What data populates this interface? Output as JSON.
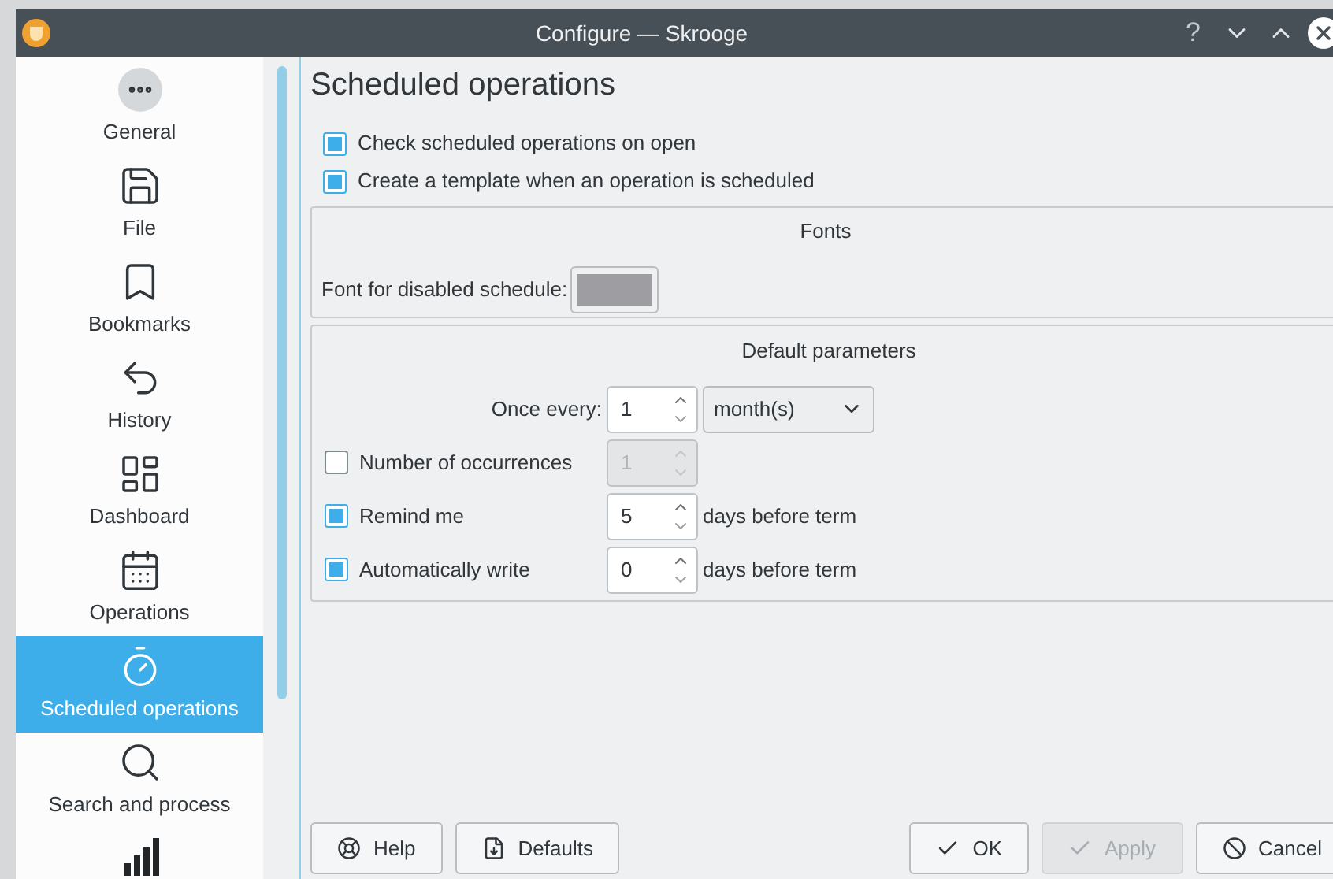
{
  "window": {
    "title": "Configure — Skrooge",
    "help_glyph": "?"
  },
  "sidebar": {
    "items": [
      {
        "label": "General",
        "selected": false
      },
      {
        "label": "File",
        "selected": false
      },
      {
        "label": "Bookmarks",
        "selected": false
      },
      {
        "label": "History",
        "selected": false
      },
      {
        "label": "Dashboard",
        "selected": false
      },
      {
        "label": "Operations",
        "selected": false
      },
      {
        "label": "Scheduled operations",
        "selected": true
      },
      {
        "label": "Search and process",
        "selected": false
      }
    ]
  },
  "page": {
    "title": "Scheduled operations",
    "options": [
      {
        "label": "Check scheduled operations on open",
        "checked": true
      },
      {
        "label": "Create a template when an operation is scheduled",
        "checked": true
      }
    ],
    "fonts_group": {
      "title": "Fonts",
      "label": "Font for disabled schedule:",
      "color": "#9e9ea2"
    },
    "defaults_group": {
      "title": "Default parameters",
      "once_every": {
        "label": "Once every:",
        "value": "1",
        "unit": "month(s)"
      },
      "rows": [
        {
          "label": "Number of occurrences",
          "checked": false,
          "value": "1",
          "disabled": true
        },
        {
          "label": "Remind me",
          "checked": true,
          "value": "5",
          "disabled": false,
          "suffix": "days before term"
        },
        {
          "label": "Automatically write",
          "checked": true,
          "value": "0",
          "disabled": false,
          "suffix": "days before term"
        }
      ]
    }
  },
  "buttons": [
    {
      "label": "Help",
      "kind": "help",
      "disabled": false
    },
    {
      "label": "Defaults",
      "kind": "defaults",
      "disabled": false
    },
    {
      "label": "OK",
      "kind": "ok",
      "disabled": false
    },
    {
      "label": "Apply",
      "kind": "apply",
      "disabled": true
    },
    {
      "label": "Cancel",
      "kind": "cancel",
      "disabled": false
    }
  ]
}
